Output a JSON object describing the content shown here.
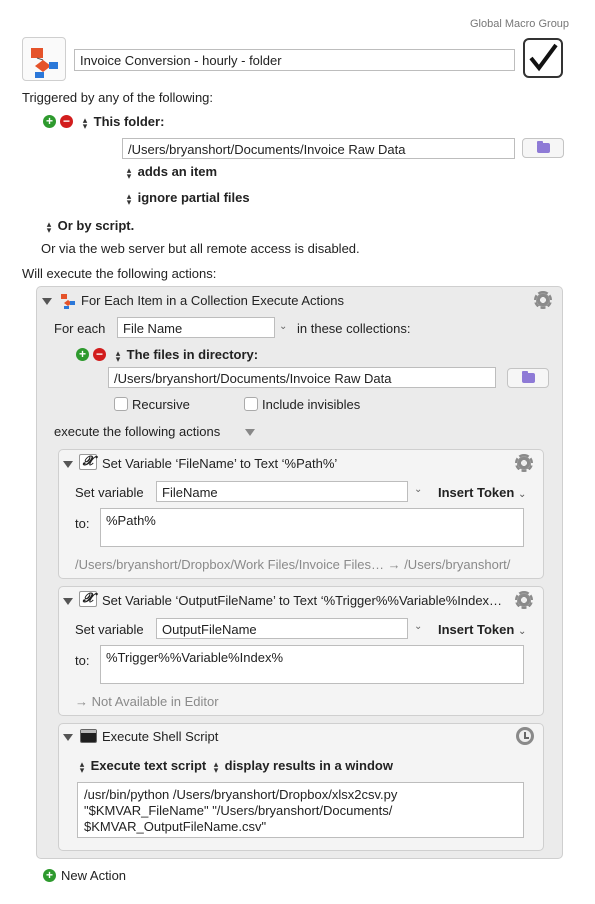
{
  "group_label": "Global Macro Group",
  "macro": {
    "name": "Invoice Conversion - hourly - folder",
    "enabled_icon": "checkmark-icon"
  },
  "triggers": {
    "heading": "Triggered by any of the following:",
    "folder_trigger_label": "This folder:",
    "folder_path": "/Users/bryanshort/Documents/Invoice Raw Data",
    "adds_item": "adds an item",
    "ignore_partial": "ignore partial files",
    "or_by_script": "Or by script.",
    "web_server_note": "Or via the web server but all remote access is disabled."
  },
  "actions_heading": "Will execute the following actions:",
  "for_each": {
    "title": "For Each Item in a Collection Execute Actions",
    "for_each_label": "For each",
    "variable": "File Name",
    "in_collections": "in these collections:",
    "collection_label": "The files in directory:",
    "directory": "/Users/bryanshort/Documents/Invoice Raw Data",
    "recursive_label": "Recursive",
    "invisibles_label": "Include invisibles",
    "execute_label": "execute the following actions"
  },
  "set_var_1": {
    "title": "Set Variable ‘FileName’ to Text ‘%Path%’",
    "set_variable_label": "Set variable",
    "variable": "FileName",
    "insert_token": "Insert Token",
    "to_label": "to:",
    "value": "%Path%",
    "preview": "/Users/bryanshort/Dropbox/Work Files/Invoice Files… → /Users/bryanshort/"
  },
  "set_var_2": {
    "title": "Set Variable ‘OutputFileName’ to Text ‘%Trigger%%Variable%Index…",
    "set_variable_label": "Set variable",
    "variable": "OutputFileName",
    "insert_token": "Insert Token",
    "to_label": "to:",
    "value": "%Trigger%%Variable%Index%",
    "preview": "→ Not Available in Editor"
  },
  "shell": {
    "title": "Execute Shell Script",
    "execute_mode": "Execute text script",
    "output_mode": "display results in a window",
    "script_lines": [
      "/usr/bin/python /Users/bryanshort/Dropbox/xlsx2csv.py",
      "\"$KMVAR_FileName\" \"/Users/bryanshort/Documents/",
      "$KMVAR_OutputFileName.csv\""
    ]
  },
  "new_action": "New Action"
}
